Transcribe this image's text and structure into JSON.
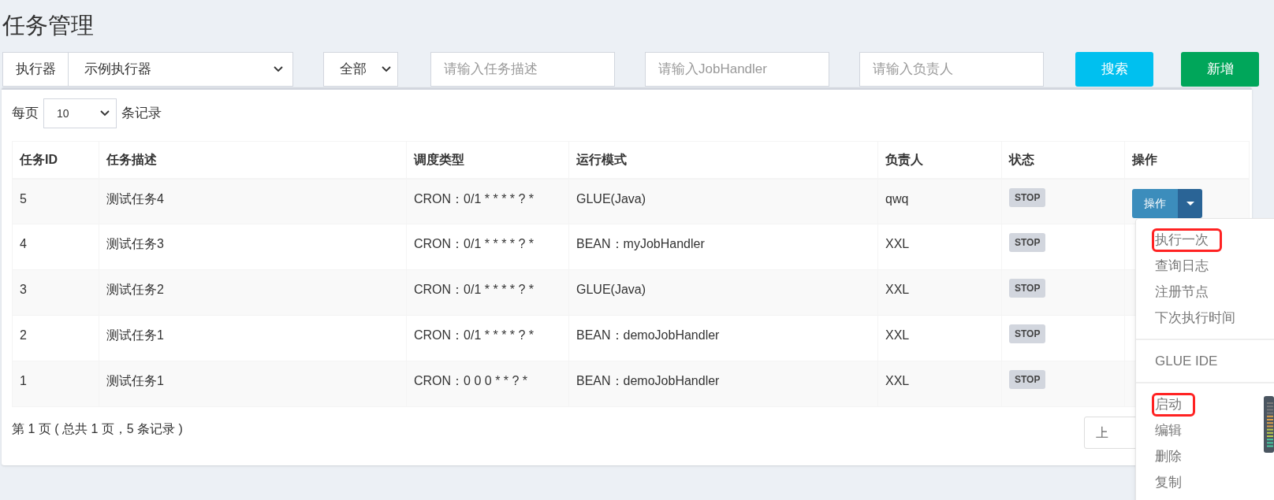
{
  "page_title": "任务管理",
  "filters": {
    "executor_label": "执行器",
    "executor_value": "示例执行器",
    "status_value": "全部",
    "fields": [
      {
        "placeholder": "请输入任务描述"
      },
      {
        "placeholder": "请输入JobHandler"
      },
      {
        "placeholder": "请输入负责人"
      }
    ],
    "search_button": "搜索",
    "add_button": "新增"
  },
  "page_size": {
    "prefix": "每页",
    "value": "10",
    "suffix": "条记录"
  },
  "table": {
    "columns": [
      "任务ID",
      "任务描述",
      "调度类型",
      "运行模式",
      "负责人",
      "状态",
      "操作"
    ],
    "rows": [
      {
        "cells": [
          "5",
          "测试任务4",
          "CRON：0/1 * * * * ? *",
          "GLUE(Java)",
          "qwq"
        ],
        "status": "STOP",
        "action": "操作"
      },
      {
        "cells": [
          "4",
          "测试任务3",
          "CRON：0/1 * * * * ? *",
          "BEAN：myJobHandler",
          "XXL"
        ],
        "status": "STOP"
      },
      {
        "cells": [
          "3",
          "测试任务2",
          "CRON：0/1 * * * * ? *",
          "GLUE(Java)",
          "XXL"
        ],
        "status": "STOP"
      },
      {
        "cells": [
          "2",
          "测试任务1",
          "CRON：0/1 * * * * ? *",
          "BEAN：demoJobHandler",
          "XXL"
        ],
        "status": "STOP"
      },
      {
        "cells": [
          "1",
          "测试任务1",
          "CRON：0 0 0 * * ? *",
          "BEAN：demoJobHandler",
          "XXL"
        ],
        "status": "STOP"
      }
    ]
  },
  "footer": "第 1 页 ( 总共 1 页，5 条记录 )",
  "pager_button": "上",
  "menu": {
    "groups": [
      [
        {
          "label": "执行一次",
          "highlighted": true
        },
        {
          "label": "查询日志",
          "highlighted": false
        },
        {
          "label": "注册节点",
          "highlighted": false
        },
        {
          "label": "下次执行时间",
          "highlighted": false
        }
      ],
      [
        {
          "label": "GLUE IDE",
          "highlighted": false
        }
      ],
      [
        {
          "label": "启动",
          "highlighted": true
        },
        {
          "label": "编辑",
          "highlighted": false
        },
        {
          "label": "删除",
          "highlighted": false
        },
        {
          "label": "复制",
          "highlighted": false
        }
      ]
    ]
  }
}
